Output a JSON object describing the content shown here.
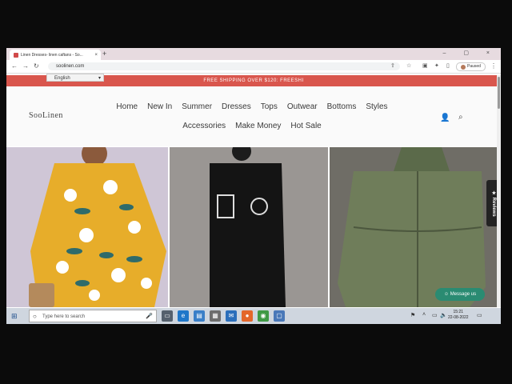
{
  "browser": {
    "tab_title": "Linen Dresses- linen caftans - So...",
    "tab_close": "×",
    "new_tab": "+",
    "url": "soolinen.com",
    "profile_label": "Paused",
    "window_controls": "–  ▢  ×"
  },
  "site": {
    "language": "English",
    "promo": "FREE SHIPPING OVER $120: FREESHI",
    "logo": "SooLinen",
    "nav_row1": [
      "Home",
      "New In",
      "Summer",
      "Dresses",
      "Tops",
      "Outwear",
      "Bottoms",
      "Styles"
    ],
    "nav_row2": [
      "Accessories",
      "Make Money",
      "Hot Sale"
    ],
    "reviews_label": "★ Reviews",
    "message_label": "☺ Message us"
  },
  "taskbar": {
    "search_placeholder": "Type here to search",
    "time": "15:21",
    "date": "22-08-2022"
  },
  "colors": {
    "promo_bar": "#d9564d",
    "message_button": "#2a8b72",
    "reviews_tab": "#232323"
  },
  "icons": [
    "back-icon",
    "forward-icon",
    "reload-icon",
    "share-icon",
    "star-icon",
    "extensions-icon",
    "account-icon",
    "search-icon",
    "windows-start-icon",
    "microphone-icon"
  ]
}
